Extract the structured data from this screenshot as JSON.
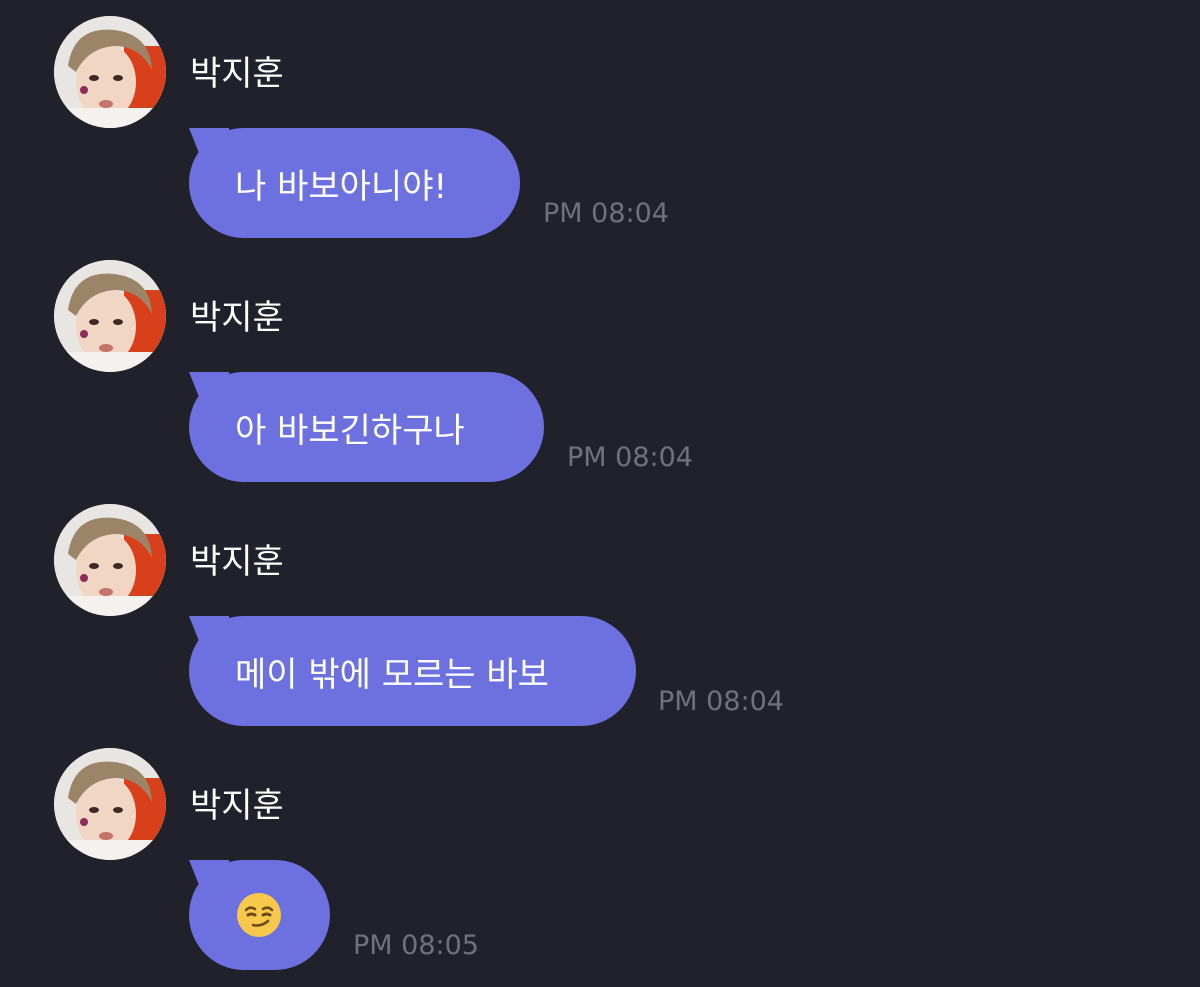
{
  "colors": {
    "background": "#20212b",
    "bubble": "#6c71df",
    "sender_text": "#ffffff",
    "timestamp": "#6f717c"
  },
  "messages": [
    {
      "sender": "박지훈",
      "text": "나 바보아니야!",
      "time": "PM 08:04"
    },
    {
      "sender": "박지훈",
      "text": "아 바보긴하구나",
      "time": "PM 08:04"
    },
    {
      "sender": "박지훈",
      "text": "메이 밖에 모르는 바보",
      "time": "PM 08:04"
    },
    {
      "sender": "박지훈",
      "text": "",
      "emoji": "smirking-face-emoji",
      "time": "PM 08:05"
    }
  ]
}
